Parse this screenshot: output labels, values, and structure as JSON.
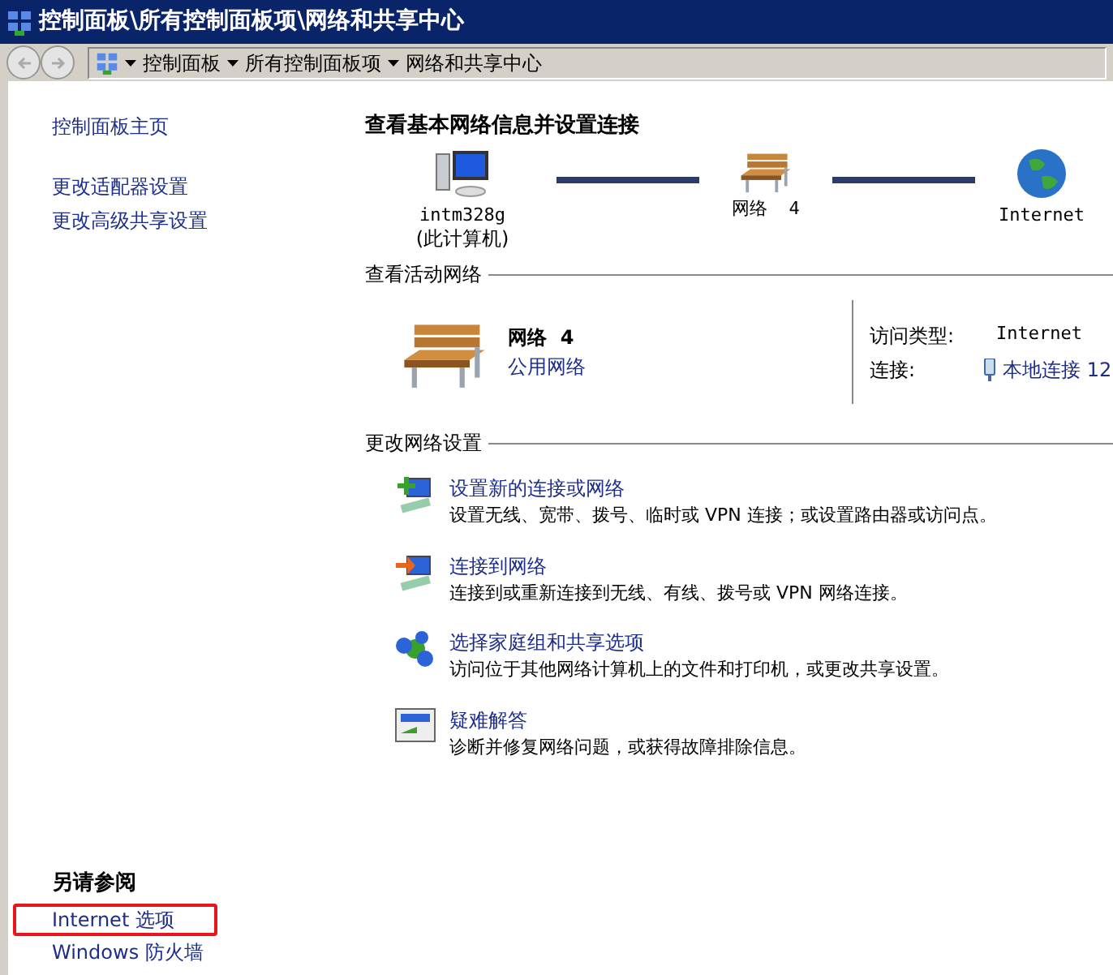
{
  "window": {
    "title": "控制面板\\所有控制面板项\\网络和共享中心"
  },
  "breadcrumb": [
    "控制面板",
    "所有控制面板项",
    "网络和共享中心"
  ],
  "sidebar": {
    "links": [
      {
        "label": "控制面板主页"
      },
      {
        "label": "更改适配器设置"
      },
      {
        "label": "更改高级共享设置"
      }
    ],
    "see_also": {
      "title": "另请参阅",
      "items": [
        {
          "label": "Internet 选项",
          "highlighted": true
        },
        {
          "label": "Windows 防火墙",
          "highlighted": false
        }
      ]
    }
  },
  "main": {
    "heading": "查看基本网络信息并设置连接",
    "map": [
      {
        "kind": "computer",
        "label": "intm328g",
        "sublabel": "(此计算机)"
      },
      {
        "kind": "bench",
        "label": "网络  4"
      },
      {
        "kind": "globe",
        "label": "Internet"
      }
    ],
    "active": {
      "heading": "查看活动网络",
      "name": "网络  4",
      "type": "公用网络",
      "access_label": "访问类型:",
      "access_value": "Internet",
      "conn_label": "连接:",
      "conn_value": "本地连接 12"
    },
    "settings": {
      "heading": "更改网络设置",
      "items": [
        {
          "kind": "new",
          "title": "设置新的连接或网络",
          "desc": "设置无线、宽带、拨号、临时或 VPN 连接；或设置路由器或访问点。"
        },
        {
          "kind": "connect",
          "title": "连接到网络",
          "desc": "连接到或重新连接到无线、有线、拨号或 VPN 网络连接。"
        },
        {
          "kind": "homegroup",
          "title": "选择家庭组和共享选项",
          "desc": "访问位于其他网络计算机上的文件和打印机，或更改共享设置。"
        },
        {
          "kind": "trouble",
          "title": "疑难解答",
          "desc": "诊断并修复网络问题，或获得故障排除信息。"
        }
      ]
    }
  }
}
